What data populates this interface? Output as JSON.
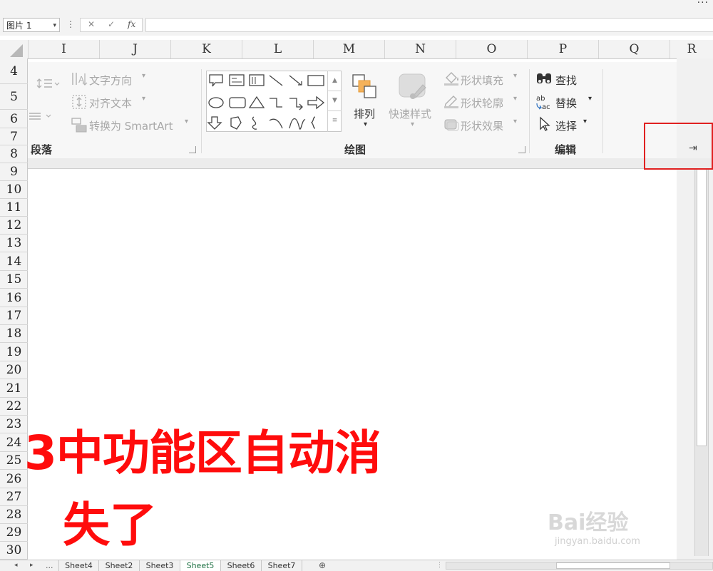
{
  "formula_bar": {
    "name_box": "图片 1",
    "name_box_arrow": "▾",
    "more": "⋮",
    "cancel_glyph": "✕",
    "enter_glyph": "✓",
    "fx_glyph": "fx",
    "formula_value": ""
  },
  "window": {
    "more_dots": "···"
  },
  "columns": [
    "I",
    "J",
    "K",
    "L",
    "M",
    "N",
    "O",
    "P",
    "Q",
    "R"
  ],
  "rows": [
    "4",
    "5",
    "6",
    "7",
    "8",
    "9",
    "10",
    "11",
    "12",
    "13",
    "14",
    "15",
    "16",
    "17",
    "18",
    "19",
    "20",
    "21",
    "22",
    "23",
    "24",
    "25",
    "26",
    "27",
    "28",
    "29",
    "30"
  ],
  "ribbon": {
    "paragraph": {
      "label": "段落",
      "text_direction": "文字方向",
      "align_text": "对齐文本",
      "convert_smartart": "转换为 SmartArt"
    },
    "drawing": {
      "label": "绘图",
      "arrange": "排列",
      "quick_styles": "快速样式",
      "shape_fill": "形状填充",
      "shape_outline": "形状轮廓",
      "shape_effects": "形状效果"
    },
    "editing": {
      "label": "编辑",
      "find": "查找",
      "replace": "替换",
      "select": "选择"
    },
    "pin_glyph": "⇥"
  },
  "overlay": {
    "line1": "3中功能区自动消",
    "line2": "失了"
  },
  "watermark": {
    "brand": "Bai经验",
    "url": "jingyan.baidu.com"
  },
  "sheet_tabs": {
    "ellipsis": "...",
    "tabs": [
      "Sheet4",
      "Sheet2",
      "Sheet3",
      "Sheet5",
      "Sheet6",
      "Sheet7"
    ],
    "active": "Sheet5",
    "add_glyph": "⊕"
  },
  "colors": {
    "overlay_text": "#ff0c0c",
    "highlight_box": "#e02020",
    "active_tab": "#217346"
  }
}
